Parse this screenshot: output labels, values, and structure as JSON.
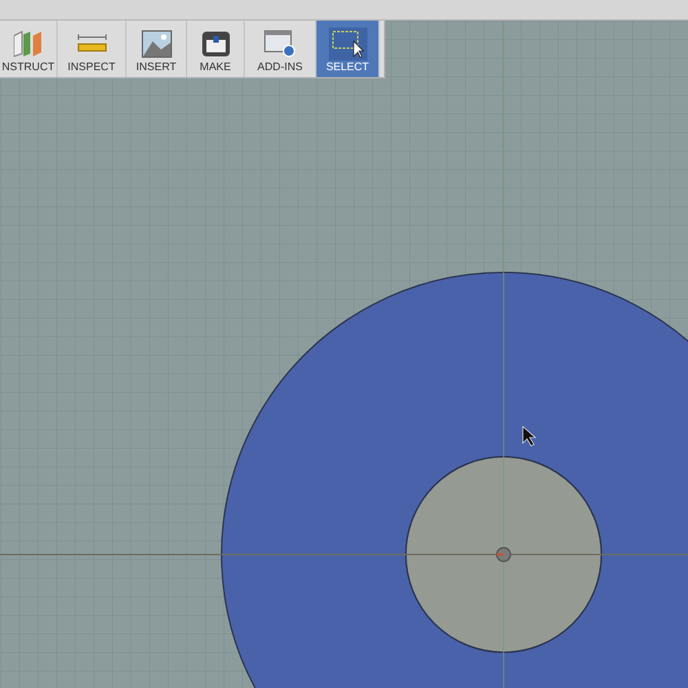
{
  "toolbar": [
    {
      "kind": "construct",
      "label": "NSTRUCT",
      "selected": false
    },
    {
      "kind": "inspect",
      "label": "INSPECT",
      "selected": false
    },
    {
      "kind": "insert",
      "label": "INSERT",
      "selected": false
    },
    {
      "kind": "make",
      "label": "MAKE",
      "selected": false
    },
    {
      "kind": "addins",
      "label": "ADD-INS",
      "selected": false
    },
    {
      "kind": "select",
      "label": "SELECT",
      "selected": true
    }
  ]
}
